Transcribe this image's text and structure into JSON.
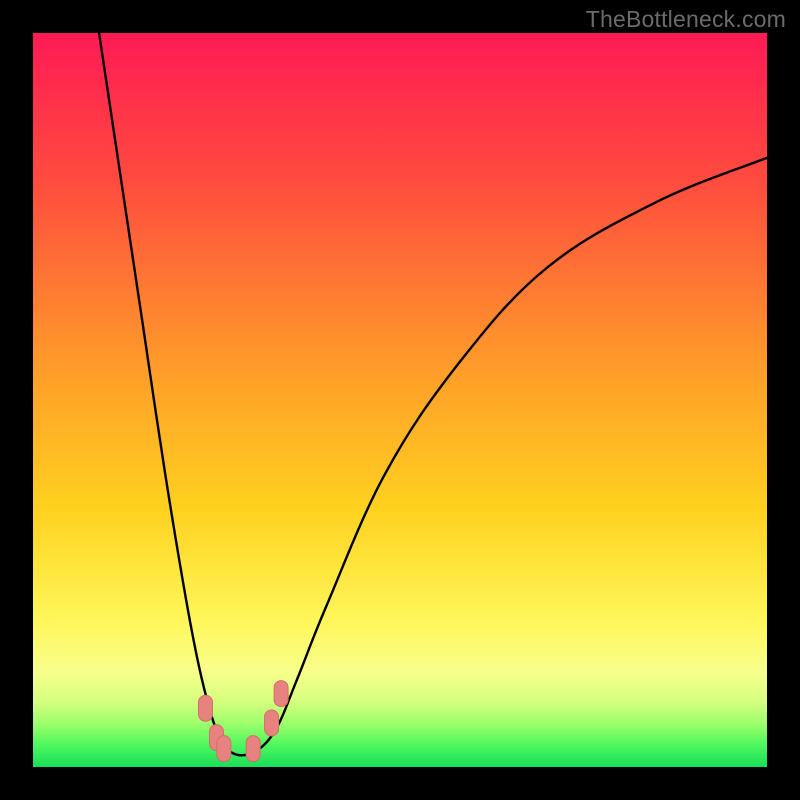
{
  "attribution": "TheBottleneck.com",
  "colors": {
    "frame_bg": "#000000",
    "curve_stroke": "#000000",
    "marker_fill": "#e6837e",
    "marker_stroke": "#d46e69",
    "green_band": "#1fe05a",
    "mid_band": "#f8ff8a"
  },
  "chart_data": {
    "type": "line",
    "title": "",
    "xlabel": "",
    "ylabel": "",
    "x_range": [
      0,
      100
    ],
    "y_range": [
      0,
      100
    ],
    "note": "No axis ticks or numeric labels are drawn; values are visual estimates of the V-curve in 0–100 space (percent of plot width/height from lower-left).",
    "series": [
      {
        "name": "bottleneck-curve",
        "points": [
          {
            "x": 9,
            "y": 100
          },
          {
            "x": 12,
            "y": 80
          },
          {
            "x": 15,
            "y": 60
          },
          {
            "x": 18,
            "y": 40
          },
          {
            "x": 21,
            "y": 22
          },
          {
            "x": 23,
            "y": 12
          },
          {
            "x": 25,
            "y": 5
          },
          {
            "x": 27,
            "y": 2
          },
          {
            "x": 30,
            "y": 2
          },
          {
            "x": 33,
            "y": 5
          },
          {
            "x": 36,
            "y": 12
          },
          {
            "x": 40,
            "y": 22
          },
          {
            "x": 48,
            "y": 40
          },
          {
            "x": 58,
            "y": 55
          },
          {
            "x": 70,
            "y": 68
          },
          {
            "x": 85,
            "y": 77
          },
          {
            "x": 100,
            "y": 83
          }
        ]
      }
    ],
    "markers": [
      {
        "x": 23.5,
        "y": 8
      },
      {
        "x": 25,
        "y": 4
      },
      {
        "x": 26,
        "y": 2.5
      },
      {
        "x": 30,
        "y": 2.5
      },
      {
        "x": 32.5,
        "y": 6
      },
      {
        "x": 33.8,
        "y": 10
      }
    ],
    "gradient_stops": [
      {
        "pct": 0,
        "color": "#ff1a55"
      },
      {
        "pct": 20,
        "color": "#ff4b3f"
      },
      {
        "pct": 45,
        "color": "#ff9a2a"
      },
      {
        "pct": 65,
        "color": "#ffd21f"
      },
      {
        "pct": 80,
        "color": "#fff65a"
      },
      {
        "pct": 87,
        "color": "#f8ff8a"
      },
      {
        "pct": 91,
        "color": "#d6ff80"
      },
      {
        "pct": 94,
        "color": "#9fff6b"
      },
      {
        "pct": 97,
        "color": "#4ff75f"
      },
      {
        "pct": 100,
        "color": "#17df57"
      }
    ]
  }
}
